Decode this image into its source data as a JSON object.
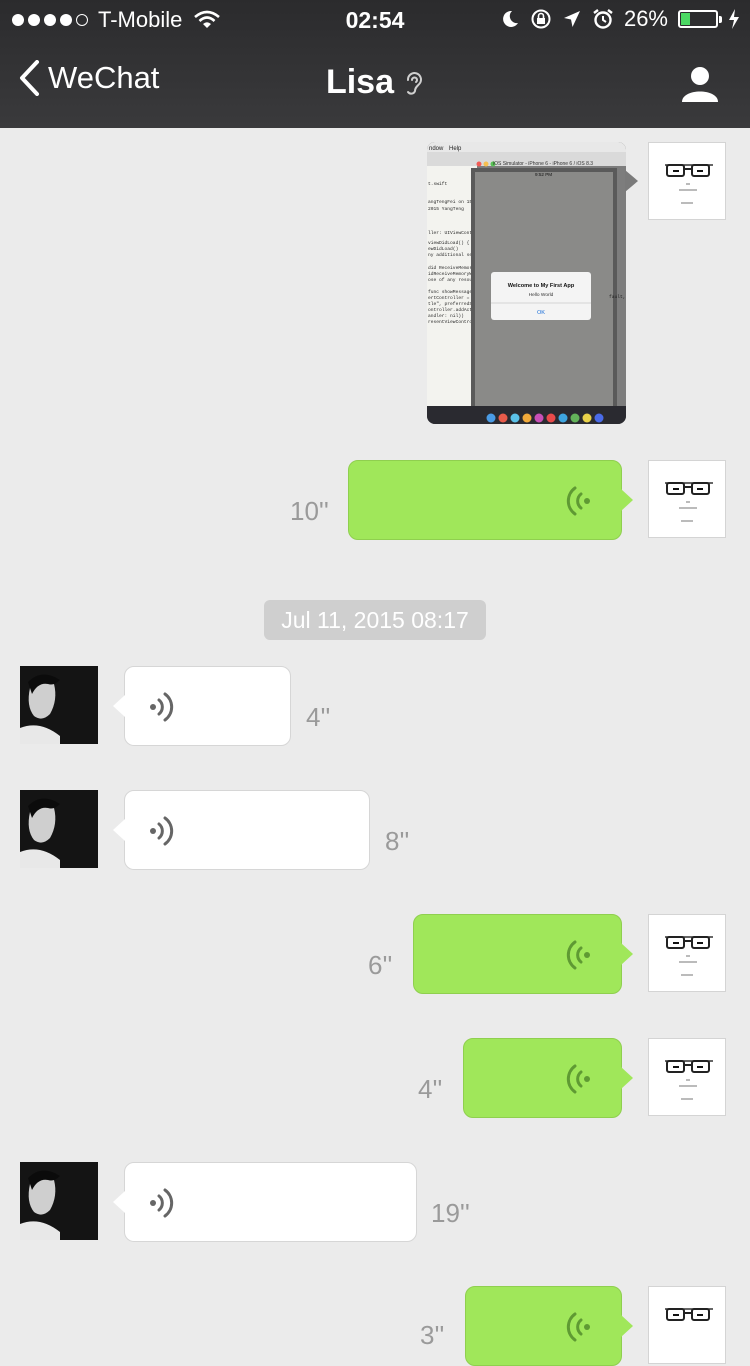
{
  "status_bar": {
    "carrier": "T-Mobile",
    "time": "02:54",
    "battery_percent": "26%",
    "battery_level": 0.26,
    "icons": [
      "signal-dots-icon",
      "wifi-icon",
      "moon-icon",
      "rotation-lock-icon",
      "location-arrow-icon",
      "alarm-icon",
      "battery-icon",
      "charging-bolt-icon"
    ]
  },
  "nav": {
    "back_label": "WeChat",
    "title": "Lisa",
    "title_icon": "ear-icon",
    "right_icon": "profile-icon"
  },
  "image_message": {
    "direction": "outgoing",
    "content": {
      "menu_items": [
        "ndow",
        "Help"
      ],
      "window_title": "iOS Simulator - iPhone 6 - iPhone 6 / iOS 8.3",
      "sim_time": "9:52 PM",
      "code_lines": [
        "t.swift",
        "angTengFei on 15/",
        "2015 YangTeng",
        "ller: UIViewContr",
        "viewDidLoad() {",
        "ewDidLoad()",
        "ny additional setu",
        "did ReceiveMemor",
        "idReceiveMemoryWar",
        "ose of any resourc",
        "func showMessage()",
        "ertController = UI",
        "tle\", preferredSty",
        "ontroller.addActio",
        "andler: nil))",
        "resentViewControll"
      ],
      "alert_title": "Welcome to My First App",
      "alert_message": "Hello World",
      "alert_button": "OK",
      "stray_text": "fault,"
    }
  },
  "timestamp": "Jul 11, 2015 08:17",
  "messages": [
    {
      "direction": "outgoing",
      "duration": "10''"
    },
    {
      "direction": "incoming",
      "duration": "4''"
    },
    {
      "direction": "incoming",
      "duration": "8''"
    },
    {
      "direction": "outgoing",
      "duration": "6''"
    },
    {
      "direction": "outgoing",
      "duration": "4''"
    },
    {
      "direction": "incoming",
      "duration": "19''"
    },
    {
      "direction": "outgoing",
      "duration": "3''"
    }
  ],
  "colors": {
    "nav_bg": "#2b2b2d",
    "chat_bg": "#ebebeb",
    "outgoing_bubble": "#a0e75a",
    "incoming_bubble": "#ffffff",
    "wave_outgoing": "#5f9a33",
    "wave_incoming": "#666666"
  }
}
